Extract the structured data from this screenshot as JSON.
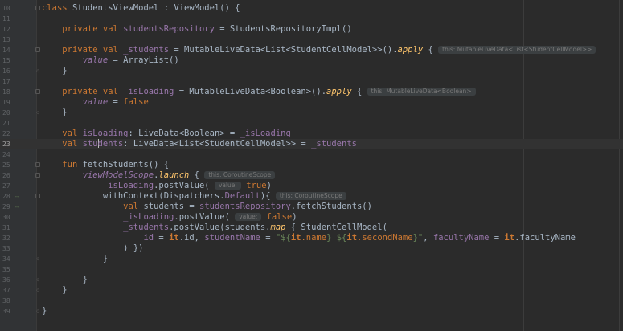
{
  "editor": {
    "lines": [
      {
        "num": "10",
        "fold": "start",
        "segs": [
          {
            "t": "class ",
            "c": "kw"
          },
          {
            "t": "StudentsViewModel : ViewModel() {"
          }
        ]
      },
      {
        "num": "11",
        "segs": []
      },
      {
        "num": "12",
        "segs": [
          {
            "t": "    "
          },
          {
            "t": "private val ",
            "c": "kw"
          },
          {
            "t": "studentsRepository",
            "c": "prop"
          },
          {
            "t": " = StudentsRepositoryImpl()"
          }
        ]
      },
      {
        "num": "13",
        "segs": []
      },
      {
        "num": "14",
        "fold": "start",
        "segs": [
          {
            "t": "    "
          },
          {
            "t": "private val ",
            "c": "kw"
          },
          {
            "t": "_students",
            "c": "prop"
          },
          {
            "t": " = MutableLiveData<List<StudentCellModel>>()."
          },
          {
            "t": "apply",
            "c": "fn-italic"
          },
          {
            "t": " { "
          },
          {
            "hint": "this: MutableLiveData<List<StudentCellModel>>"
          }
        ]
      },
      {
        "num": "15",
        "segs": [
          {
            "t": "        "
          },
          {
            "t": "value",
            "c": "italic-prop"
          },
          {
            "t": " = ArrayList()"
          }
        ]
      },
      {
        "num": "16",
        "fold": "end",
        "segs": [
          {
            "t": "    }"
          }
        ]
      },
      {
        "num": "17",
        "segs": []
      },
      {
        "num": "18",
        "fold": "start",
        "segs": [
          {
            "t": "    "
          },
          {
            "t": "private val ",
            "c": "kw"
          },
          {
            "t": "_isLoading",
            "c": "prop"
          },
          {
            "t": " = MutableLiveData<Boolean>()."
          },
          {
            "t": "apply",
            "c": "fn-italic"
          },
          {
            "t": " { "
          },
          {
            "hint": "this: MutableLiveData<Boolean>"
          }
        ]
      },
      {
        "num": "19",
        "segs": [
          {
            "t": "        "
          },
          {
            "t": "value",
            "c": "italic-prop"
          },
          {
            "t": " = "
          },
          {
            "t": "false",
            "c": "kw"
          }
        ]
      },
      {
        "num": "20",
        "fold": "end",
        "segs": [
          {
            "t": "    }"
          }
        ]
      },
      {
        "num": "21",
        "segs": []
      },
      {
        "num": "22",
        "segs": [
          {
            "t": "    "
          },
          {
            "t": "val ",
            "c": "kw"
          },
          {
            "t": "isLoading",
            "c": "prop"
          },
          {
            "t": ": LiveData<Boolean> = "
          },
          {
            "t": "_isLoading",
            "c": "prop"
          }
        ]
      },
      {
        "num": "23",
        "current": true,
        "segs": [
          {
            "t": "    "
          },
          {
            "t": "val ",
            "c": "kw"
          },
          {
            "t": "stu",
            "c": "prop"
          },
          {
            "caret": true
          },
          {
            "t": "dents",
            "c": "prop"
          },
          {
            "t": ": LiveData<List<StudentCellModel>> = "
          },
          {
            "t": "_students",
            "c": "prop"
          }
        ]
      },
      {
        "num": "24",
        "segs": []
      },
      {
        "num": "25",
        "fold": "start",
        "segs": [
          {
            "t": "    "
          },
          {
            "t": "fun ",
            "c": "kw"
          },
          {
            "t": "fetchStudents() {"
          }
        ]
      },
      {
        "num": "26",
        "fold": "start",
        "segs": [
          {
            "t": "        "
          },
          {
            "t": "viewModelScope",
            "c": "italic-prop"
          },
          {
            "t": "."
          },
          {
            "t": "launch",
            "c": "fn-italic"
          },
          {
            "t": " { "
          },
          {
            "hint": "this: CoroutineScope"
          }
        ]
      },
      {
        "num": "27",
        "segs": [
          {
            "t": "            "
          },
          {
            "t": "_isLoading",
            "c": "prop"
          },
          {
            "t": ".postValue( "
          },
          {
            "hint": "value:"
          },
          {
            "t": " "
          },
          {
            "t": "true",
            "c": "kw"
          },
          {
            "t": ")"
          }
        ]
      },
      {
        "num": "28",
        "marker": "⇢",
        "fold": "start",
        "segs": [
          {
            "t": "            withContext(Dispatchers."
          },
          {
            "t": "Default",
            "c": "prop"
          },
          {
            "t": "){ "
          },
          {
            "hint": "this: CoroutineScope"
          }
        ]
      },
      {
        "num": "29",
        "marker": "⇢",
        "segs": [
          {
            "t": "                "
          },
          {
            "t": "val ",
            "c": "kw"
          },
          {
            "t": "students = "
          },
          {
            "t": "studentsRepository",
            "c": "prop"
          },
          {
            "t": ".fetchStudents()"
          }
        ]
      },
      {
        "num": "30",
        "segs": [
          {
            "t": "                "
          },
          {
            "t": "_isLoading",
            "c": "prop"
          },
          {
            "t": ".postValue( "
          },
          {
            "hint": "value:"
          },
          {
            "t": " "
          },
          {
            "t": "false",
            "c": "kw"
          },
          {
            "t": ")"
          }
        ]
      },
      {
        "num": "31",
        "segs": [
          {
            "t": "                "
          },
          {
            "t": "_students",
            "c": "prop"
          },
          {
            "t": ".postValue(students."
          },
          {
            "t": "map",
            "c": "fn-italic"
          },
          {
            "t": " { StudentCellModel("
          }
        ]
      },
      {
        "num": "32",
        "segs": [
          {
            "t": "                    "
          },
          {
            "t": "id",
            "c": "prop"
          },
          {
            "t": " = "
          },
          {
            "t": "it",
            "c": "it"
          },
          {
            "t": ".id, "
          },
          {
            "t": "studentName",
            "c": "prop"
          },
          {
            "t": " = "
          },
          {
            "t": "\"${",
            "c": "str"
          },
          {
            "t": "it",
            "c": "it"
          },
          {
            "t": ".name",
            "c": "kw"
          },
          {
            "t": "} ${",
            "c": "str"
          },
          {
            "t": "it",
            "c": "it"
          },
          {
            "t": ".secondName",
            "c": "kw"
          },
          {
            "t": "}\"",
            "c": "str"
          },
          {
            "t": ", "
          },
          {
            "t": "facultyName",
            "c": "prop"
          },
          {
            "t": " = "
          },
          {
            "t": "it",
            "c": "it"
          },
          {
            "t": ".facultyName"
          }
        ]
      },
      {
        "num": "33",
        "segs": [
          {
            "t": "                ) })"
          }
        ]
      },
      {
        "num": "34",
        "fold": "end",
        "segs": [
          {
            "t": "            }"
          }
        ]
      },
      {
        "num": "35",
        "segs": []
      },
      {
        "num": "36",
        "fold": "end",
        "segs": [
          {
            "t": "        }"
          }
        ]
      },
      {
        "num": "37",
        "fold": "end",
        "segs": [
          {
            "t": "    }"
          }
        ]
      },
      {
        "num": "38",
        "segs": []
      },
      {
        "num": "39",
        "fold": "end",
        "segs": [
          {
            "t": "}"
          }
        ]
      }
    ]
  }
}
